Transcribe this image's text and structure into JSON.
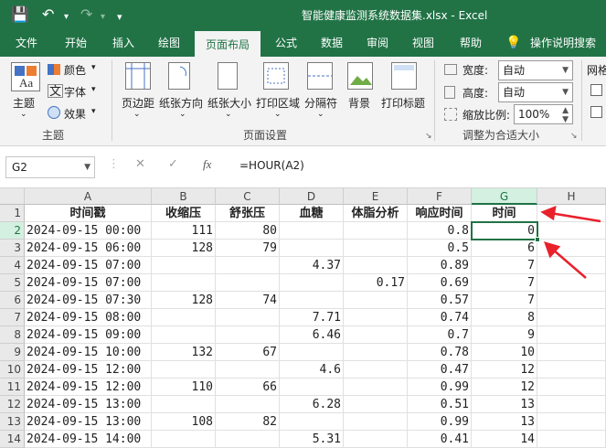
{
  "window": {
    "title": "智能健康监测系统数据集.xlsx  -  Excel"
  },
  "tabs": [
    "文件",
    "开始",
    "插入",
    "绘图",
    "页面布局",
    "公式",
    "数据",
    "审阅",
    "视图",
    "帮助",
    "操作说明搜索"
  ],
  "active_tab": "页面布局",
  "ribbon": {
    "theme": {
      "label": "主题",
      "colors": "颜色",
      "fonts": "字体",
      "effects": "效果",
      "group": "主题"
    },
    "page_setup": {
      "margins": "页边距",
      "orientation": "纸张方向",
      "size": "纸张大小",
      "print_area": "打印区域",
      "breaks": "分隔符",
      "background": "背景",
      "print_titles": "打印标题",
      "group": "页面设置"
    },
    "scale": {
      "width_label": "宽度:",
      "width_value": "自动",
      "height_label": "高度:",
      "height_value": "自动",
      "scale_label": "缩放比例:",
      "scale_value": "100%",
      "group": "调整为合适大小"
    },
    "sheet_options": {
      "label": "网格"
    }
  },
  "formula_bar": {
    "name_box": "G2",
    "formula": "=HOUR(A2)",
    "fx": "fx"
  },
  "columns": [
    "A",
    "B",
    "C",
    "D",
    "E",
    "F",
    "G",
    "H"
  ],
  "header_row": [
    "时间戳",
    "收缩压",
    "舒张压",
    "血糖",
    "体脂分析",
    "响应时间",
    "时间",
    ""
  ],
  "rows": [
    {
      "n": "2",
      "a": "2024-09-15 00:00",
      "b": "111",
      "c": "80",
      "d": "",
      "e": "",
      "f": "0.8",
      "g": "0"
    },
    {
      "n": "3",
      "a": "2024-09-15 06:00",
      "b": "128",
      "c": "79",
      "d": "",
      "e": "",
      "f": "0.5",
      "g": "6"
    },
    {
      "n": "4",
      "a": "2024-09-15 07:00",
      "b": "",
      "c": "",
      "d": "4.37",
      "e": "",
      "f": "0.89",
      "g": "7"
    },
    {
      "n": "5",
      "a": "2024-09-15 07:00",
      "b": "",
      "c": "",
      "d": "",
      "e": "0.17",
      "f": "0.69",
      "g": "7"
    },
    {
      "n": "6",
      "a": "2024-09-15 07:30",
      "b": "128",
      "c": "74",
      "d": "",
      "e": "",
      "f": "0.57",
      "g": "7"
    },
    {
      "n": "7",
      "a": "2024-09-15 08:00",
      "b": "",
      "c": "",
      "d": "7.71",
      "e": "",
      "f": "0.74",
      "g": "8"
    },
    {
      "n": "8",
      "a": "2024-09-15 09:00",
      "b": "",
      "c": "",
      "d": "6.46",
      "e": "",
      "f": "0.7",
      "g": "9"
    },
    {
      "n": "9",
      "a": "2024-09-15 10:00",
      "b": "132",
      "c": "67",
      "d": "",
      "e": "",
      "f": "0.78",
      "g": "10"
    },
    {
      "n": "10",
      "a": "2024-09-15 12:00",
      "b": "",
      "c": "",
      "d": "4.6",
      "e": "",
      "f": "0.47",
      "g": "12"
    },
    {
      "n": "11",
      "a": "2024-09-15 12:00",
      "b": "110",
      "c": "66",
      "d": "",
      "e": "",
      "f": "0.99",
      "g": "12"
    },
    {
      "n": "12",
      "a": "2024-09-15 13:00",
      "b": "",
      "c": "",
      "d": "6.28",
      "e": "",
      "f": "0.51",
      "g": "13"
    },
    {
      "n": "13",
      "a": "2024-09-15 13:00",
      "b": "108",
      "c": "82",
      "d": "",
      "e": "",
      "f": "0.99",
      "g": "13"
    },
    {
      "n": "14",
      "a": "2024-09-15 14:00",
      "b": "",
      "c": "",
      "d": "5.31",
      "e": "",
      "f": "0.41",
      "g": "14"
    }
  ],
  "colors": {
    "brand": "#217346",
    "annotation_arrow": "#e8212b"
  }
}
